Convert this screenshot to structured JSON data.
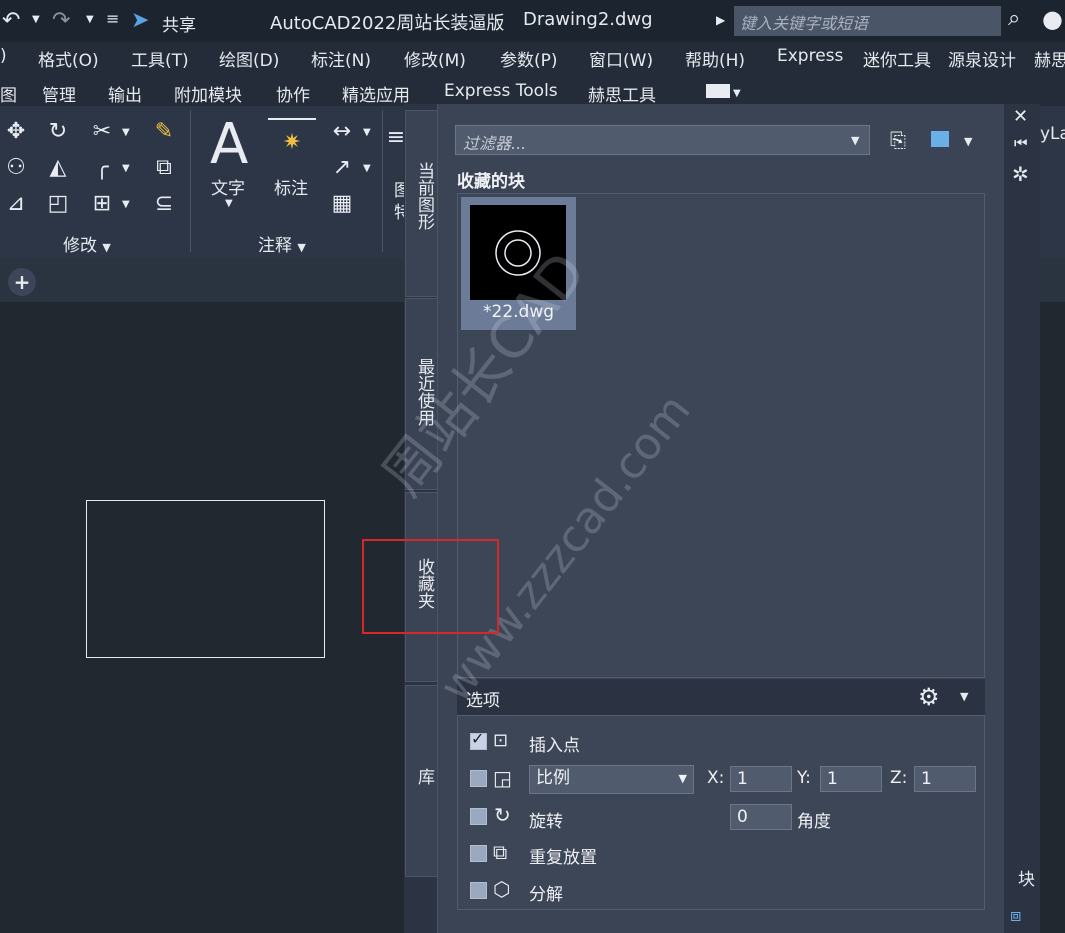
{
  "title_bar": {
    "share_label": "共享",
    "app_title": "AutoCAD2022周站长装逼版",
    "doc_title": "Drawing2.dwg",
    "search_placeholder": "键入关键字或短语"
  },
  "menu": [
    ")",
    "格式(O)",
    "工具(T)",
    "绘图(D)",
    "标注(N)",
    "修改(M)",
    "参数(P)",
    "窗口(W)",
    "帮助(H)",
    "Express",
    "迷你工具",
    "源泉设计",
    "赫思"
  ],
  "ribbon_tabs": [
    "图",
    "管理",
    "输出",
    "附加模块",
    "协作",
    "精选应用",
    "Express Tools",
    "赫思工具"
  ],
  "ribbon": {
    "modify_group": "修改",
    "annotation_group": "注释",
    "text_label": "文字",
    "dimension_label": "标注",
    "big_letter": "A",
    "partial_label_1": "图",
    "partial_label_2": "特",
    "right_partial": "yLa"
  },
  "file_tabs": {
    "add_symbol": "+"
  },
  "palette": {
    "vertical_tabs": [
      "当前图形",
      "最近使用",
      "收藏夹",
      "库"
    ],
    "filter_placeholder": "过滤器...",
    "favorites_label": "收藏的块",
    "blocks": [
      {
        "name": "*22.dwg"
      }
    ],
    "options_title": "选项",
    "options": {
      "insertion_point": {
        "label": "插入点",
        "checked": true
      },
      "scale": {
        "label": "比例",
        "checked": false,
        "x_label": "X:",
        "x": "1",
        "y_label": "Y:",
        "y": "1",
        "z_label": "Z:",
        "z": "1"
      },
      "rotate": {
        "label": "旋转",
        "checked": false,
        "value": "0",
        "unit": "角度"
      },
      "repeat": {
        "label": "重复放置",
        "checked": false
      },
      "explode": {
        "label": "分解",
        "checked": false
      }
    },
    "side_title": "块"
  },
  "watermark": {
    "line1": "周站长CAD",
    "line2": "www.zzzcad.com"
  },
  "colors": {
    "highlight": "#d62828",
    "background": "#212830",
    "panel": "#3b4455"
  }
}
